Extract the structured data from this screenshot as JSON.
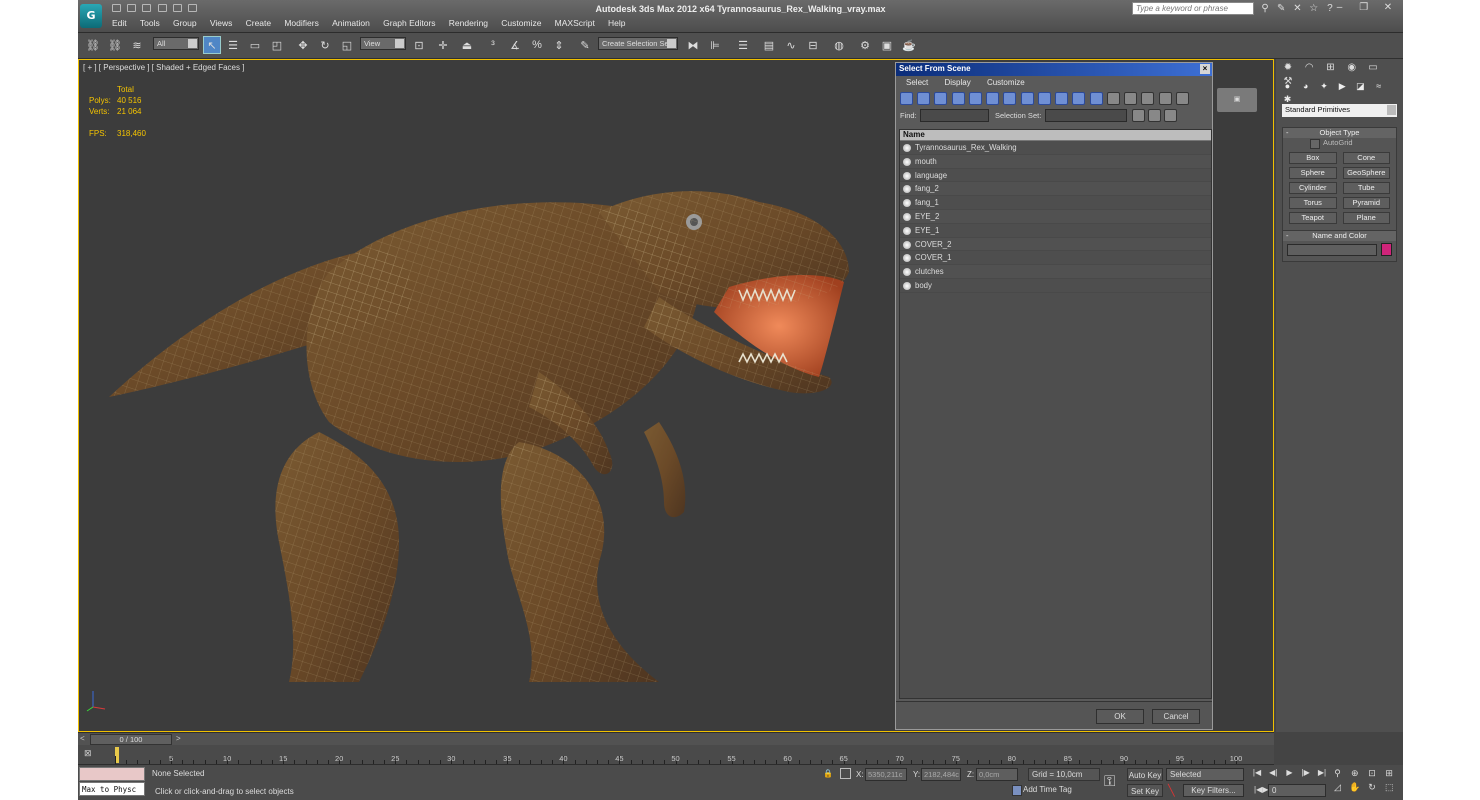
{
  "app": {
    "logo": "G",
    "title": "Autodesk 3ds Max  2012 x64     Tyrannosaurus_Rex_Walking_vray.max",
    "search_placeholder": "Type a keyword or phrase"
  },
  "menu": [
    "Edit",
    "Tools",
    "Group",
    "Views",
    "Create",
    "Modifiers",
    "Animation",
    "Graph Editors",
    "Rendering",
    "Customize",
    "MAXScript",
    "Help"
  ],
  "toolbar": {
    "selection_filter": "All",
    "reference_coord": "View",
    "selection_set": "Create Selection Se"
  },
  "viewport": {
    "label": "[ + ] [ Perspective ] [ Shaded + Edged Faces ]",
    "stats_header": "Total",
    "polys_label": "Polys:",
    "polys_value": "40 516",
    "verts_label": "Verts:",
    "verts_value": "21 064",
    "fps_label": "FPS:",
    "fps_value": "318,460"
  },
  "select_from_scene": {
    "title": "Select From Scene",
    "menu": [
      "Select",
      "Display",
      "Customize"
    ],
    "find_label": "Find:",
    "selection_set_label": "Selection Set:",
    "column_name": "Name",
    "objects": [
      "Tyrannosaurus_Rex_Walking",
      "mouth",
      "language",
      "fang_2",
      "fang_1",
      "EYE_2",
      "EYE_1",
      "COVER_2",
      "COVER_1",
      "clutches",
      "body"
    ],
    "ok": "OK",
    "cancel": "Cancel"
  },
  "command_panel": {
    "category": "Standard Primitives",
    "object_type_title": "Object Type",
    "autogrid": "AutoGrid",
    "buttons": [
      "Box",
      "Cone",
      "Sphere",
      "GeoSphere",
      "Cylinder",
      "Tube",
      "Torus",
      "Pyramid",
      "Teapot",
      "Plane"
    ],
    "name_color_title": "Name and Color",
    "color": "#d0247a"
  },
  "timeline": {
    "slider_label": "0 / 100",
    "ticks": [
      "5",
      "10",
      "15",
      "20",
      "25",
      "30",
      "35",
      "40",
      "45",
      "50",
      "55",
      "60",
      "65",
      "70",
      "75",
      "80",
      "85",
      "90",
      "95",
      "100"
    ]
  },
  "status": {
    "maxscript": "Max to Physc",
    "selection": "None Selected",
    "prompt": "Click or click-and-drag to select objects",
    "x_label": "X:",
    "x_value": "5350,211c",
    "y_label": "Y:",
    "y_value": "2182,484c",
    "z_label": "Z:",
    "z_value": "0,0cm",
    "grid": "Grid = 10,0cm",
    "add_time_tag": "Add Time Tag",
    "auto_key": "Auto Key",
    "set_key": "Set Key",
    "key_mode": "Selected",
    "key_filters": "Key Filters...",
    "frame": "0"
  }
}
